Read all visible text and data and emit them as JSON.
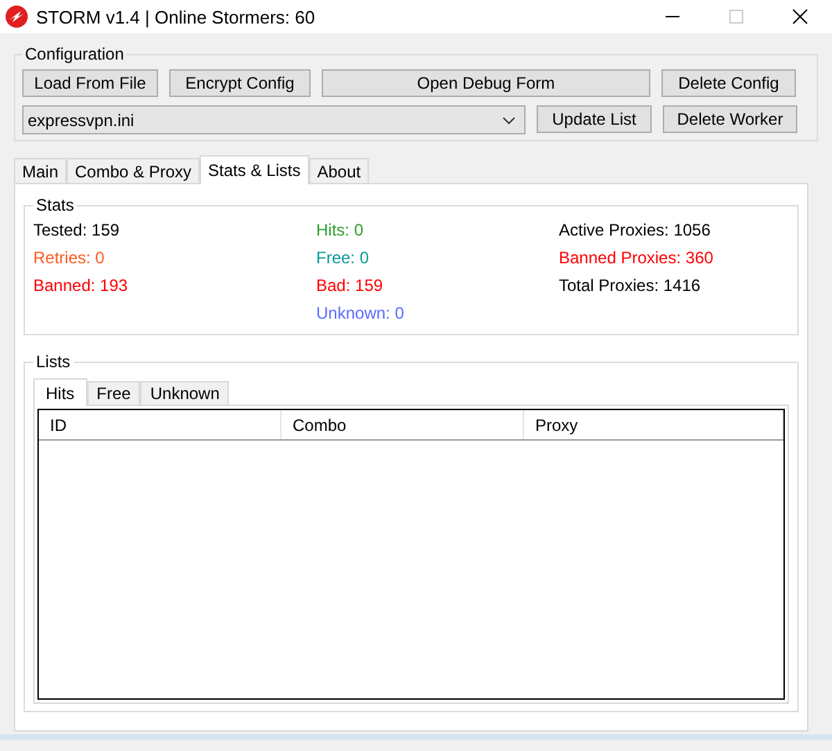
{
  "window": {
    "title": "STORM v1.4 | Online Stormers: 60"
  },
  "configuration": {
    "title": "Configuration",
    "top_buttons": [
      "Load From File",
      "Encrypt Config",
      "Open Debug Form",
      "Delete Config"
    ],
    "profile": {
      "value": "expressvpn.ini"
    },
    "bottom_buttons": [
      "Update List",
      "Delete Worker"
    ]
  },
  "tabs": [
    {
      "label": "Main",
      "selected": false
    },
    {
      "label": "Combo & Proxy",
      "selected": false
    },
    {
      "label": "Stats & Lists",
      "selected": true
    },
    {
      "label": "About",
      "selected": false
    }
  ],
  "stats": {
    "title": "Stats",
    "columns": [
      [
        {
          "text": "Tested: 159",
          "color": "#000000"
        },
        {
          "text": "Retries: 0",
          "color": "#ff5a1e"
        },
        {
          "text": "Banned: 193",
          "color": "#ff0000"
        }
      ],
      [
        {
          "text": "Hits: 0",
          "color": "#2e9e2e"
        },
        {
          "text": "Free: 0",
          "color": "#0a9a9a"
        },
        {
          "text": "Bad: 159",
          "color": "#ff0000"
        },
        {
          "text": "Unknown: 0",
          "color": "#5a6cff"
        }
      ],
      [
        {
          "text": "Active Proxies: 1056",
          "color": "#000000"
        },
        {
          "text": "Banned Proxies: 360",
          "color": "#ff0000"
        },
        {
          "text": "Total Proxies: 1416",
          "color": "#000000"
        }
      ]
    ]
  },
  "lists": {
    "title": "Lists",
    "tabs": [
      {
        "label": "Hits",
        "selected": true
      },
      {
        "label": "Free",
        "selected": false
      },
      {
        "label": "Unknown",
        "selected": false
      }
    ],
    "columns": [
      "ID",
      "Combo",
      "Proxy"
    ]
  }
}
